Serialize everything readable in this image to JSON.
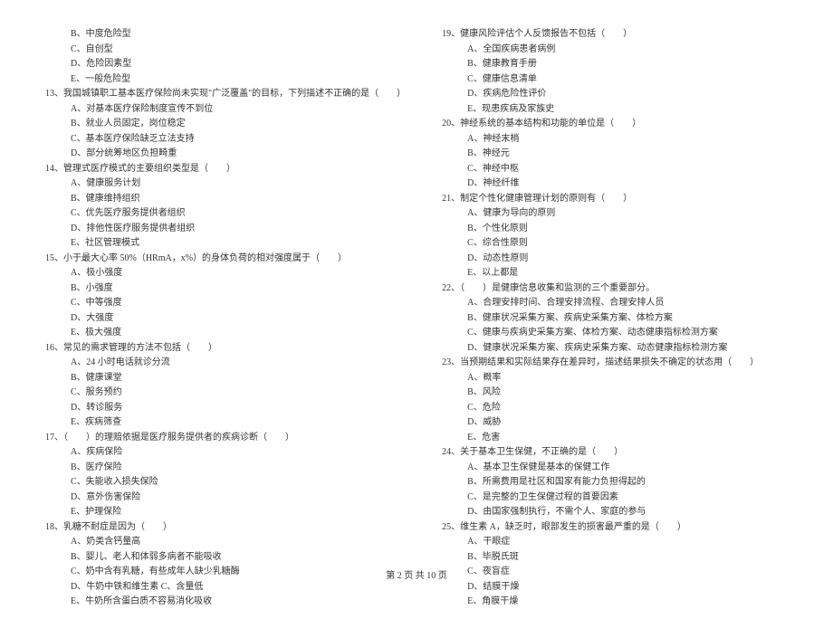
{
  "left_column": [
    {
      "type": "option",
      "text": "B、中度危险型"
    },
    {
      "type": "option",
      "text": "C、自创型"
    },
    {
      "type": "option",
      "text": "D、危险因素型"
    },
    {
      "type": "option",
      "text": "E、一般危险型"
    },
    {
      "type": "stem",
      "text": "13、我国城镇职工基本医疗保险尚未实现\"广泛覆盖\"的目标，下列描述不正确的是（　　）"
    },
    {
      "type": "option",
      "text": "A、对基本医疗保险制度宣传不到位"
    },
    {
      "type": "option",
      "text": "B、就业人员固定，岗位稳定"
    },
    {
      "type": "option",
      "text": "C、基本医疗保险缺乏立法支持"
    },
    {
      "type": "option",
      "text": "D、部分统筹地区负担畸重"
    },
    {
      "type": "stem",
      "text": "14、管理式医疗模式的主要组织类型是（　　）"
    },
    {
      "type": "option",
      "text": "A、健康服务计划"
    },
    {
      "type": "option",
      "text": "B、健康维持组织"
    },
    {
      "type": "option",
      "text": "C、优先医疗服务提供者组织"
    },
    {
      "type": "option",
      "text": "D、排他性医疗服务提供者组织"
    },
    {
      "type": "option",
      "text": "E、社区管理模式"
    },
    {
      "type": "stem",
      "text": "15、小于最大心率 50%（HRmA，x%）的身体负荷的相对强度属于（　　）"
    },
    {
      "type": "option",
      "text": "A、极小强度"
    },
    {
      "type": "option",
      "text": "B、小强度"
    },
    {
      "type": "option",
      "text": "C、中等强度"
    },
    {
      "type": "option",
      "text": "D、大强度"
    },
    {
      "type": "option",
      "text": "E、极大强度"
    },
    {
      "type": "stem",
      "text": "16、常见的需求管理的方法不包括（　　）"
    },
    {
      "type": "option",
      "text": "A、24 小时电话就诊分流"
    },
    {
      "type": "option",
      "text": "B、健康课堂"
    },
    {
      "type": "option",
      "text": "C、服务预约"
    },
    {
      "type": "option",
      "text": "D、转诊服务"
    },
    {
      "type": "option",
      "text": "E、疾病筛查"
    },
    {
      "type": "stem",
      "text": "17、（　　）的理赔依据是医疗服务提供者的疾病诊断（　　）"
    },
    {
      "type": "option",
      "text": "A、疾病保险"
    },
    {
      "type": "option",
      "text": "B、医疗保险"
    },
    {
      "type": "option",
      "text": "C、失能收入损失保险"
    },
    {
      "type": "option",
      "text": "D、意外伤害保险"
    },
    {
      "type": "option",
      "text": "E、护理保险"
    },
    {
      "type": "stem",
      "text": "18、乳糖不耐症是因为（　　）"
    },
    {
      "type": "option",
      "text": "A、奶类含钙量高"
    },
    {
      "type": "option",
      "text": "B、婴儿、老人和体弱多病者不能吸收"
    },
    {
      "type": "option",
      "text": "C、奶中含有乳糖，有些成年人缺少乳糖酶"
    },
    {
      "type": "option",
      "text": "D、牛奶中铁和维生素 C、含量低"
    },
    {
      "type": "option",
      "text": "E、牛奶所含蛋白质不容易消化吸收"
    }
  ],
  "right_column": [
    {
      "type": "stem",
      "text": "19、健康风险评估个人反馈报告不包括（　　）"
    },
    {
      "type": "option",
      "text": "A、全国疾病患者病例"
    },
    {
      "type": "option",
      "text": "B、健康教育手册"
    },
    {
      "type": "option",
      "text": "C、健康信息清单"
    },
    {
      "type": "option",
      "text": "D、疾病危险性评价"
    },
    {
      "type": "option",
      "text": "E、现患疾病及家族史"
    },
    {
      "type": "stem",
      "text": "20、神经系统的基本结构和功能的单位是（　　）"
    },
    {
      "type": "option",
      "text": "A、神经末梢"
    },
    {
      "type": "option",
      "text": "B、神经元"
    },
    {
      "type": "option",
      "text": "C、神经中枢"
    },
    {
      "type": "option",
      "text": "D、神经纤维"
    },
    {
      "type": "stem",
      "text": "21、制定个性化健康管理计划的原则有（　　）"
    },
    {
      "type": "option",
      "text": "A、健康为导向的原则"
    },
    {
      "type": "option",
      "text": "B、个性化原则"
    },
    {
      "type": "option",
      "text": "C、综合性原则"
    },
    {
      "type": "option",
      "text": "D、动态性原则"
    },
    {
      "type": "option",
      "text": "E、以上都是"
    },
    {
      "type": "stem",
      "text": "22、（　　）是健康信息收集和监测的三个重要部分。"
    },
    {
      "type": "option",
      "text": "A、合理安排时间、合理安排流程、合理安排人员"
    },
    {
      "type": "option",
      "text": "B、健康状况采集方案、疾病史采集方案、体检方案"
    },
    {
      "type": "option",
      "text": "C、健康与疾病史采集方案、体检方案、动态健康指标检测方案"
    },
    {
      "type": "option",
      "text": "D、健康状况采集方案、疾病史采集方案、动态健康指标检测方案"
    },
    {
      "type": "stem",
      "text": "23、当预期结果和实际结果存在差异时，描述结果损失不确定的状态用（　　）"
    },
    {
      "type": "option",
      "text": "A、概率"
    },
    {
      "type": "option",
      "text": "B、风险"
    },
    {
      "type": "option",
      "text": "C、危险"
    },
    {
      "type": "option",
      "text": "D、威胁"
    },
    {
      "type": "option",
      "text": "E、危害"
    },
    {
      "type": "stem",
      "text": "24、关于基本卫生保健，不正确的是（　　）"
    },
    {
      "type": "option",
      "text": "A、基本卫生保健是基本的保健工作"
    },
    {
      "type": "option",
      "text": "B、所需费用是社区和国家有能力负担得起的"
    },
    {
      "type": "option",
      "text": "C、是完整的卫生保健过程的首要因素"
    },
    {
      "type": "option",
      "text": "D、由国家强制执行，不需个人、家庭的参与"
    },
    {
      "type": "stem",
      "text": "25、维生素 A，缺乏时，眼部发生的损害最严重的是（　　）"
    },
    {
      "type": "option",
      "text": "A、干眼症"
    },
    {
      "type": "option",
      "text": "B、毕脱氏斑"
    },
    {
      "type": "option",
      "text": "C、夜盲症"
    },
    {
      "type": "option",
      "text": "D、结膜干燥"
    },
    {
      "type": "option",
      "text": "E、角膜干燥"
    }
  ],
  "footer": "第 2 页 共 10 页"
}
